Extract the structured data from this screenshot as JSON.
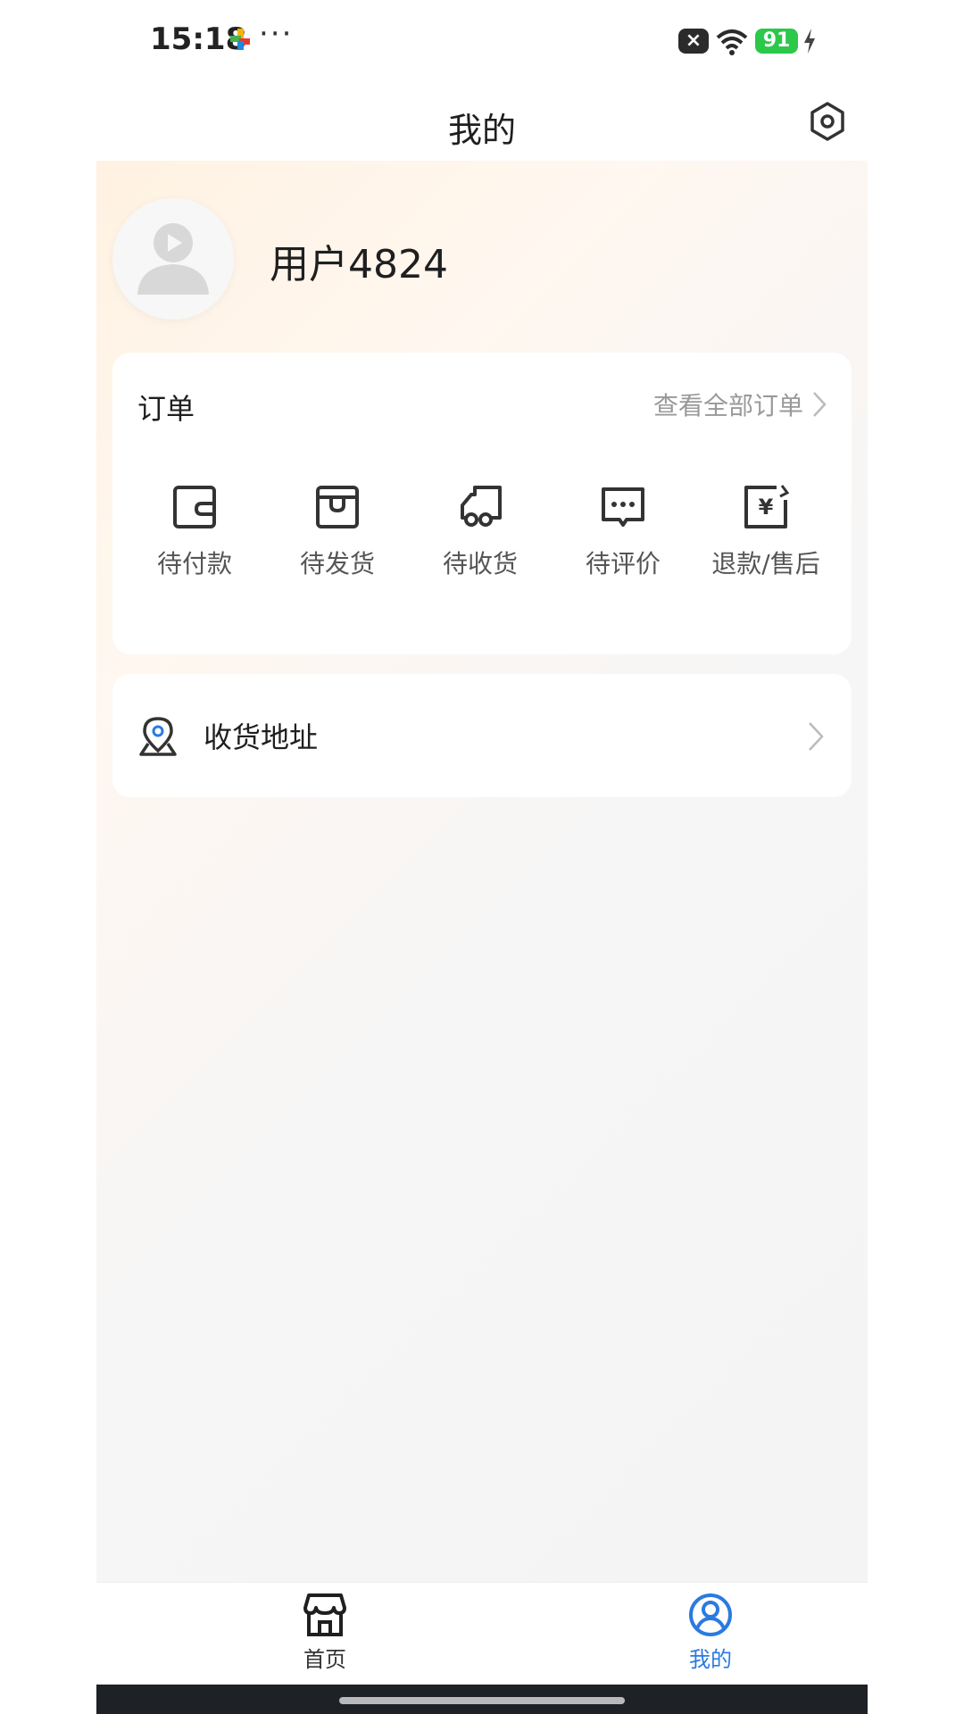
{
  "status_bar": {
    "time": "15:18",
    "more": "···",
    "battery": "91"
  },
  "header": {
    "title": "我的"
  },
  "profile": {
    "username": "用户4824"
  },
  "orders": {
    "title": "订单",
    "view_all": "查看全部订单",
    "items": [
      {
        "label": "待付款",
        "icon": "wallet-icon"
      },
      {
        "label": "待发货",
        "icon": "box-icon"
      },
      {
        "label": "待收货",
        "icon": "truck-icon"
      },
      {
        "label": "待评价",
        "icon": "comment-icon"
      },
      {
        "label": "退款/售后",
        "icon": "refund-icon"
      }
    ]
  },
  "address": {
    "label": "收货地址",
    "icon": "location-icon"
  },
  "tabs": {
    "home": "首页",
    "mine": "我的",
    "active": "mine"
  },
  "colors": {
    "accent": "#2a7ae2",
    "battery": "#2bc84a"
  }
}
